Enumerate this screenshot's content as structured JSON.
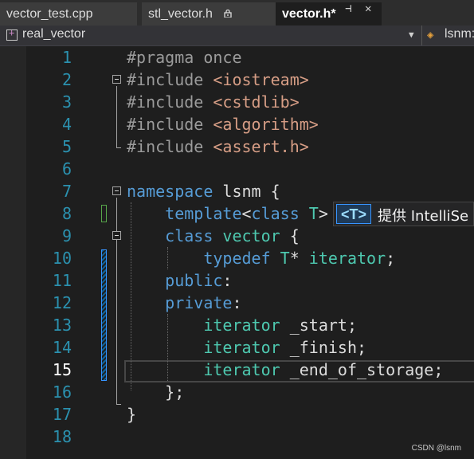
{
  "tabs": [
    {
      "label": "vector_test.cpp"
    },
    {
      "label": "stl_vector.h"
    },
    {
      "label": "vector.h*"
    }
  ],
  "tab_icons": {
    "lock": "lock-icon",
    "pin": "pin-icon",
    "close": "close-icon"
  },
  "nav": {
    "scope": "real_vector",
    "member": "lsnm:"
  },
  "lines": [
    {
      "n": "1",
      "tokens": [
        {
          "c": "dir",
          "t": "#pragma once"
        }
      ]
    },
    {
      "n": "2",
      "tokens": [
        {
          "c": "dir",
          "t": "#include "
        },
        {
          "c": "str",
          "t": "<iostream>"
        }
      ]
    },
    {
      "n": "3",
      "tokens": [
        {
          "c": "dir",
          "t": "#include "
        },
        {
          "c": "str",
          "t": "<cstdlib>"
        }
      ]
    },
    {
      "n": "4",
      "tokens": [
        {
          "c": "dir",
          "t": "#include "
        },
        {
          "c": "str",
          "t": "<algorithm>"
        }
      ]
    },
    {
      "n": "5",
      "tokens": [
        {
          "c": "dir",
          "t": "#include "
        },
        {
          "c": "str",
          "t": "<assert.h>"
        }
      ]
    },
    {
      "n": "6",
      "tokens": []
    },
    {
      "n": "7",
      "tokens": [
        {
          "c": "kw",
          "t": "namespace"
        },
        {
          "c": "txt",
          "t": " lsnm {"
        }
      ]
    },
    {
      "n": "8",
      "tokens": [
        {
          "c": "txt",
          "t": "    "
        },
        {
          "c": "kw",
          "t": "template"
        },
        {
          "c": "sym",
          "t": "<"
        },
        {
          "c": "kw",
          "t": "class"
        },
        {
          "c": "ty",
          "t": " T"
        },
        {
          "c": "sym",
          "t": ">"
        }
      ]
    },
    {
      "n": "9",
      "tokens": [
        {
          "c": "txt",
          "t": "    "
        },
        {
          "c": "kw",
          "t": "class"
        },
        {
          "c": "ty",
          "t": " vector"
        },
        {
          "c": "txt",
          "t": " {"
        }
      ]
    },
    {
      "n": "10",
      "tokens": [
        {
          "c": "txt",
          "t": "        "
        },
        {
          "c": "kw",
          "t": "typedef"
        },
        {
          "c": "ty",
          "t": " T"
        },
        {
          "c": "sym",
          "t": "*"
        },
        {
          "c": "ty",
          "t": " iterator"
        },
        {
          "c": "sym",
          "t": ";"
        }
      ]
    },
    {
      "n": "11",
      "tokens": [
        {
          "c": "txt",
          "t": "    "
        },
        {
          "c": "kw",
          "t": "public"
        },
        {
          "c": "sym",
          "t": ":"
        }
      ]
    },
    {
      "n": "12",
      "tokens": [
        {
          "c": "txt",
          "t": "    "
        },
        {
          "c": "kw",
          "t": "private"
        },
        {
          "c": "sym",
          "t": ":"
        }
      ]
    },
    {
      "n": "13",
      "tokens": [
        {
          "c": "txt",
          "t": "        "
        },
        {
          "c": "ty",
          "t": "iterator"
        },
        {
          "c": "txt",
          "t": " _start"
        },
        {
          "c": "sym",
          "t": ";"
        }
      ]
    },
    {
      "n": "14",
      "tokens": [
        {
          "c": "txt",
          "t": "        "
        },
        {
          "c": "ty",
          "t": "iterator"
        },
        {
          "c": "txt",
          "t": " _finish"
        },
        {
          "c": "sym",
          "t": ";"
        }
      ]
    },
    {
      "n": "15",
      "tokens": [
        {
          "c": "txt",
          "t": "        "
        },
        {
          "c": "ty",
          "t": "iterator"
        },
        {
          "c": "txt",
          "t": " _end_of_storage"
        },
        {
          "c": "sym",
          "t": ";"
        }
      ]
    },
    {
      "n": "16",
      "tokens": [
        {
          "c": "txt",
          "t": "    };"
        }
      ]
    },
    {
      "n": "17",
      "tokens": [
        {
          "c": "txt",
          "t": "}"
        }
      ]
    },
    {
      "n": "18",
      "tokens": []
    }
  ],
  "active_line": "15",
  "tooltip": {
    "param": "<T>",
    "text": "提供 IntelliSe"
  },
  "watermark": "CSDN @lsnm",
  "colors": {
    "keyword": "#569cd6",
    "type": "#4ec9b0",
    "string": "#d69d85",
    "directive": "#9b9b9b",
    "line_number": "#2b91af"
  }
}
